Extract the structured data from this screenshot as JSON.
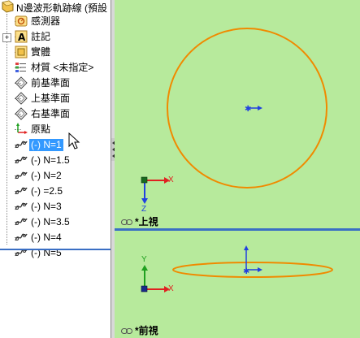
{
  "tree": {
    "title": "N邊波形軌跡線 (預設",
    "items": [
      {
        "label": "感測器",
        "icon": "sensor-icon",
        "expander": ""
      },
      {
        "label": "註記",
        "icon": "annotation-icon",
        "expander": "+"
      },
      {
        "label": "實體",
        "icon": "solid-body-icon",
        "expander": ""
      },
      {
        "label": "材質 <未指定>",
        "icon": "material-icon",
        "expander": ""
      },
      {
        "label": "前基準面",
        "icon": "plane-icon",
        "expander": ""
      },
      {
        "label": "上基準面",
        "icon": "plane-icon",
        "expander": ""
      },
      {
        "label": "右基準面",
        "icon": "plane-icon",
        "expander": ""
      },
      {
        "label": "原點",
        "icon": "origin-icon",
        "expander": ""
      },
      {
        "label": "(-) N=1",
        "icon": "curve-feature-icon",
        "expander": "",
        "selected": true
      },
      {
        "label": "(-) N=1.5",
        "icon": "curve-feature-icon",
        "expander": ""
      },
      {
        "label": "(-) N=2",
        "icon": "curve-feature-icon",
        "expander": ""
      },
      {
        "label": "(-) =2.5",
        "icon": "curve-feature-icon",
        "expander": ""
      },
      {
        "label": "(-) N=3",
        "icon": "curve-feature-icon",
        "expander": ""
      },
      {
        "label": "(-) N=3.5",
        "icon": "curve-feature-icon",
        "expander": ""
      },
      {
        "label": "(-) N=4",
        "icon": "curve-feature-icon",
        "expander": ""
      },
      {
        "label": "(-) N=5",
        "icon": "curve-feature-icon",
        "expander": ""
      }
    ]
  },
  "viewports": {
    "top": {
      "label": "*上視",
      "axis_x": "X",
      "axis_z": "Z"
    },
    "front": {
      "label": "*前視",
      "axis_x": "X",
      "axis_y": "Y"
    }
  },
  "colors": {
    "viewport_bg": "#b7ea9c",
    "curve": "#f08a00",
    "axis_x": "#e02020",
    "axis_y": "#20a020",
    "axis_z": "#2040e0",
    "selection": "#3399ff",
    "divider": "#3a6fc4"
  }
}
